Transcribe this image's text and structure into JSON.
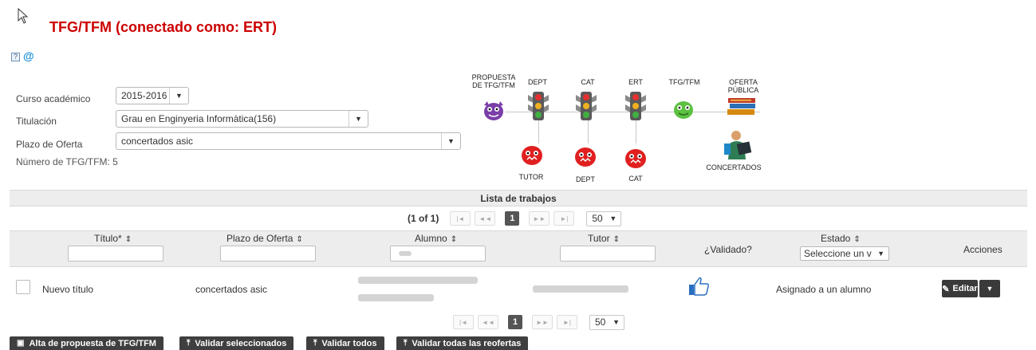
{
  "header": {
    "title": "TFG/TFM (conectado como: ERT)",
    "help_label": "?",
    "at_symbol": "@"
  },
  "form": {
    "curso": {
      "label": "Curso académico",
      "value": "2015-2016"
    },
    "titulacion": {
      "label": "Titulación",
      "value": "Grau en Enginyeria Informàtica(156)"
    },
    "plazo": {
      "label": "Plazo de Oferta",
      "value": "concertados asic"
    },
    "numero": "Número de TFG/TFM: 5"
  },
  "workflow": {
    "propuesta": "PROPUESTA\nDE TFG/TFM",
    "dept": "DEPT",
    "cat": "CAT",
    "ert": "ERT",
    "tfgtfm": "TFG/TFM",
    "oferta": "OFERTA\nPÚBLICA",
    "tutor": "TUTOR",
    "dept2": "DEPT",
    "cat2": "CAT",
    "concertados": "CONCERTADOS"
  },
  "list": {
    "title": "Lista de trabajos",
    "pager_text": "(1 of 1)",
    "current_page": "1",
    "rows_per_page": "50",
    "columns": {
      "titulo": "Título*",
      "plazo": "Plazo de Oferta",
      "alumno": "Alumno",
      "tutor": "Tutor",
      "validado": "¿Validado?",
      "estado": "Estado",
      "estado_select": "Seleccione un v",
      "acciones": "Acciones"
    },
    "rows": [
      {
        "titulo": "Nuevo título",
        "plazo": "concertados asic",
        "estado": "Asignado a un alumno",
        "edit_label": "Editar"
      }
    ]
  },
  "toolbar": {
    "alta": "Alta de propuesta de TFG/TFM",
    "validar_sel": "Validar seleccionados",
    "validar_todos": "Validar todos",
    "validar_reofertas": "Validar todas las reofertas"
  },
  "colors": {
    "title_red": "#cc0000",
    "header_grey": "#ededed",
    "button_dark": "#3f3f3f"
  }
}
